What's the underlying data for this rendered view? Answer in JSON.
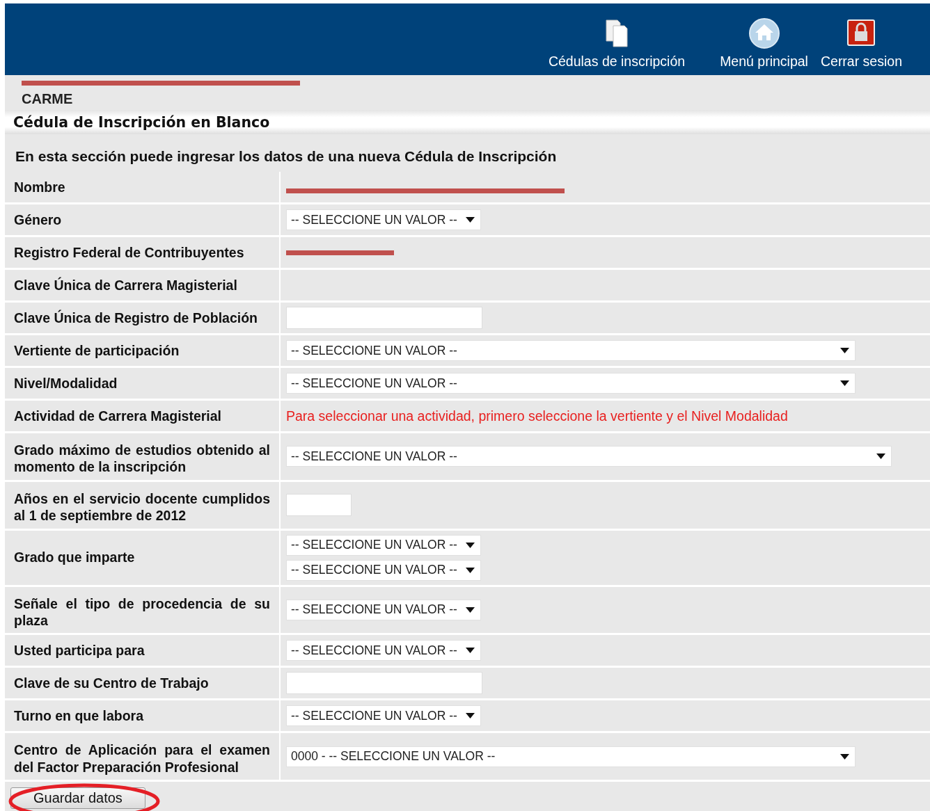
{
  "header": {
    "nav": [
      {
        "label": "Cédulas de inscripción",
        "kind": "documents"
      },
      {
        "label": "Menú principal",
        "kind": "home"
      },
      {
        "label": "Cerrar sesion",
        "kind": "lock"
      }
    ]
  },
  "user": {
    "redacted_line": true,
    "name_tail": "CARME"
  },
  "title": "Cédula de Inscripción en Blanco",
  "intro": "En esta sección puede ingresar los datos de una nueva Cédula de Inscripción",
  "rows": [
    {
      "label": "Nombre",
      "kind": "redacted-long"
    },
    {
      "label": "Género",
      "kind": "short-select",
      "values": [
        "-- SELECCIONE UN VALOR --"
      ]
    },
    {
      "label": "Registro Federal de Contribuyentes",
      "kind": "redacted-short"
    },
    {
      "label": "Clave Única de Carrera Magisterial",
      "kind": "empty"
    },
    {
      "label": "Clave Única de Registro de Población",
      "kind": "input"
    },
    {
      "label": "Vertiente de participación",
      "kind": "long-select",
      "values": [
        "-- SELECCIONE UN VALOR --"
      ]
    },
    {
      "label": "Nivel/Modalidad",
      "kind": "long-select",
      "values": [
        "-- SELECCIONE UN VALOR --"
      ]
    },
    {
      "label": "Actividad de Carrera Magisterial",
      "kind": "note",
      "note": "Para seleccionar una actividad, primero seleccione la vertiente y el Nivel Modalidad"
    },
    {
      "label": "Grado máximo de estudios obtenido al momento de la inscripción",
      "kind": "full-select",
      "values": [
        "-- SELECCIONE UN VALOR --"
      ]
    },
    {
      "label": "Años en el servicio docente cumplidos al 1 de septiembre de 2012",
      "kind": "small-input"
    },
    {
      "label": "Grado que imparte",
      "kind": "short-select",
      "values": [
        "-- SELECCIONE UN VALOR --",
        "-- SELECCIONE UN VALOR --"
      ]
    },
    {
      "label": "Señale el tipo de procedencia de su plaza",
      "kind": "short-select",
      "values": [
        "-- SELECCIONE UN VALOR --"
      ]
    },
    {
      "label": "Usted participa para",
      "kind": "short-select",
      "values": [
        "-- SELECCIONE UN VALOR --"
      ]
    },
    {
      "label": "Clave de su Centro de Trabajo",
      "kind": "input"
    },
    {
      "label": "Turno en que labora",
      "kind": "short-select",
      "values": [
        "-- SELECCIONE UN VALOR --"
      ]
    },
    {
      "label": "Centro de Aplicación para el examen del Factor Preparación Profesional",
      "kind": "long-select",
      "values": [
        "0000 - -- SELECCIONE UN VALOR --"
      ]
    }
  ],
  "save_button": {
    "label": "Guardar datos",
    "circled": true
  }
}
